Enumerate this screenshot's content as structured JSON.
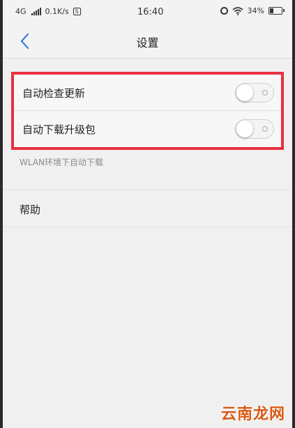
{
  "statusbar": {
    "network": "4G",
    "speed": "0.1K/s",
    "sim_icon_label": "S",
    "time": "16:40",
    "battery_pct": "34%",
    "battery_level": 0.34
  },
  "navbar": {
    "back_icon": "chevron-left-icon",
    "title": "设置"
  },
  "settings": {
    "auto_check": {
      "label": "自动检查更新",
      "enabled": false
    },
    "auto_download": {
      "label": "自动下载升级包",
      "enabled": false
    },
    "hint": "WLAN环境下自动下载"
  },
  "help": {
    "label": "帮助"
  },
  "watermark": "云南龙网",
  "colors": {
    "highlight_border": "#e8303f",
    "accent_blue": "#3f7ddc",
    "watermark": "#d85a14"
  }
}
